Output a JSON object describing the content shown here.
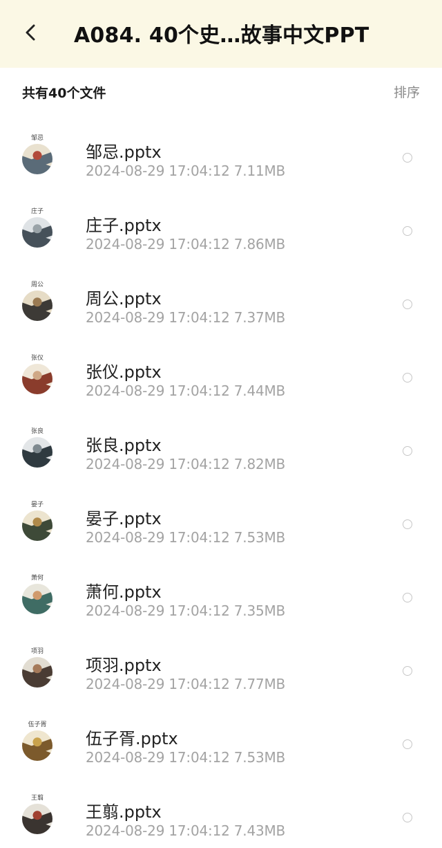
{
  "header": {
    "title": "A084. 40个史…故事中文PPT",
    "back_icon": "chevron-left-icon",
    "background": "#fbf8e5"
  },
  "summary": {
    "file_count_label": "共有40个文件",
    "sort_label": "排序"
  },
  "files": [
    {
      "thumb_caption": "邹忌",
      "name": "邹忌.pptx",
      "meta": "2024-08-29  17:04:12  7.11MB",
      "palette": [
        "#e9e1cf",
        "#5a6b78",
        "#b24a3a"
      ]
    },
    {
      "thumb_caption": "庄子",
      "name": "庄子.pptx",
      "meta": "2024-08-29  17:04:12  7.86MB",
      "palette": [
        "#dfe3e6",
        "#46515a",
        "#9aa3a8"
      ]
    },
    {
      "thumb_caption": "周公",
      "name": "周公.pptx",
      "meta": "2024-08-29  17:04:12  7.37MB",
      "palette": [
        "#e6dcc6",
        "#3d3a36",
        "#9a7a52"
      ]
    },
    {
      "thumb_caption": "张仪",
      "name": "张仪.pptx",
      "meta": "2024-08-29  17:04:12  7.44MB",
      "palette": [
        "#efe7d8",
        "#8a3c2c",
        "#cfa886"
      ]
    },
    {
      "thumb_caption": "张良",
      "name": "张良.pptx",
      "meta": "2024-08-29  17:04:12  7.82MB",
      "palette": [
        "#e3e6e8",
        "#2f3a40",
        "#7f8a90"
      ]
    },
    {
      "thumb_caption": "晏子",
      "name": "晏子.pptx",
      "meta": "2024-08-29  17:04:12  7.53MB",
      "palette": [
        "#ece4cf",
        "#3e4a38",
        "#b08a4a"
      ]
    },
    {
      "thumb_caption": "萧何",
      "name": "萧何.pptx",
      "meta": "2024-08-29  17:04:12  7.35MB",
      "palette": [
        "#e8e6dc",
        "#3f6c64",
        "#d09a6c"
      ]
    },
    {
      "thumb_caption": "项羽",
      "name": "项羽.pptx",
      "meta": "2024-08-29  17:04:12  7.77MB",
      "palette": [
        "#e2ddd2",
        "#4a3c34",
        "#a57a5a"
      ]
    },
    {
      "thumb_caption": "伍子胥",
      "name": "伍子胥.pptx",
      "meta": "2024-08-29  17:04:12  7.53MB",
      "palette": [
        "#efe6cf",
        "#7c5a2c",
        "#c9a24c"
      ]
    },
    {
      "thumb_caption": "王翦",
      "name": "王翦.pptx",
      "meta": "2024-08-29  17:04:12  7.43MB",
      "palette": [
        "#e5e1d8",
        "#3a3430",
        "#a04030"
      ]
    }
  ]
}
